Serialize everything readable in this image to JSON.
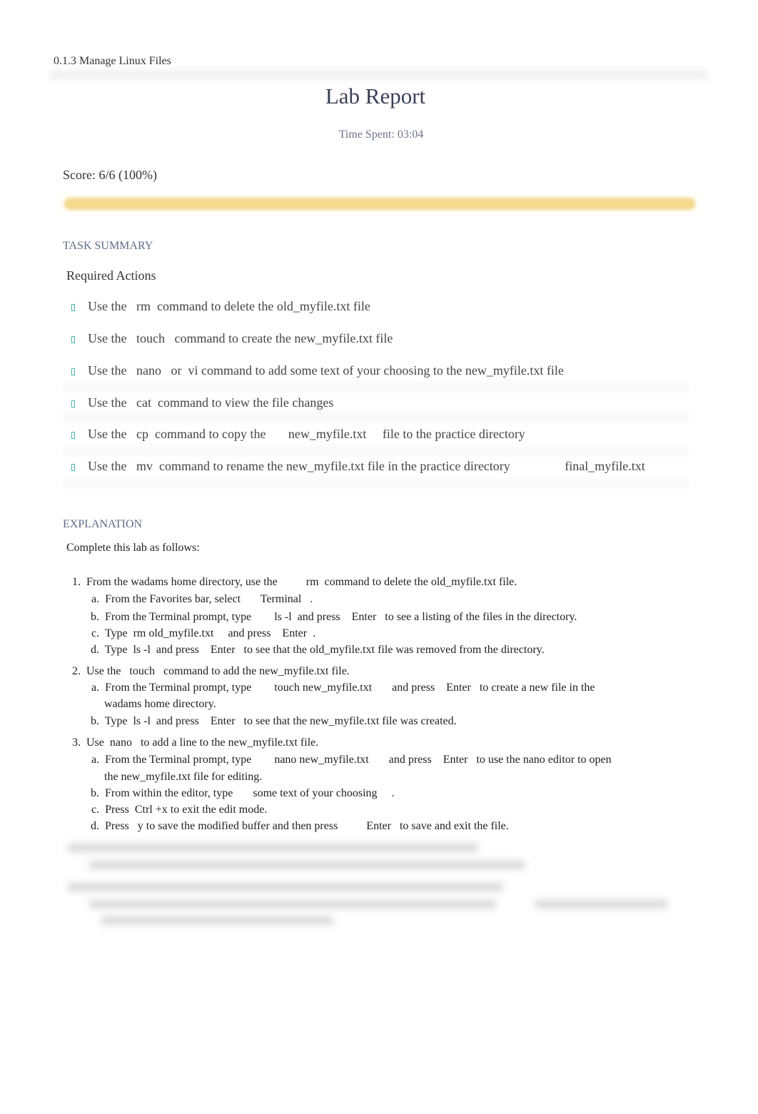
{
  "header": {
    "course": "0.1.3 Manage Linux Files"
  },
  "report": {
    "title": "Lab Report",
    "time_spent": "Time Spent: 03:04",
    "score": "Score: 6/6 (100%)",
    "score_percent": 100,
    "progress_color": "#f4d98f"
  },
  "task_summary": {
    "heading": "TASK SUMMARY",
    "subheading": "Required Actions",
    "icon": "check-icon",
    "items": [
      "Use the   rm  command to delete the old_myfile.txt file",
      "Use the   touch   command to create the new_myfile.txt file",
      "Use the   nano   or  vi command to add some text of your choosing to the new_myfile.txt file",
      "Use the   cat  command to view the file changes",
      "Use the   cp  command to copy the       new_myfile.txt     file to the practice directory",
      "Use the   mv  command to rename the new_myfile.txt file in the practice directory                 final_myfile.txt"
    ]
  },
  "explanation": {
    "heading": "EXPLANATION",
    "intro": "Complete this lab as follows:",
    "lines": [
      "1.  From the wadams home directory, use the          rm  command to delete the old_myfile.txt file.",
      "a.  From the Favorites bar, select       Terminal   .",
      "b.  From the Terminal prompt, type        ls -l  and press    Enter   to see a listing of the files in the directory.",
      "c.  Type  rm old_myfile.txt     and press    Enter  .",
      "d.  Type  ls -l  and press    Enter   to see that the old_myfile.txt file was removed from the directory.",
      "2.  Use the   touch   command to add the new_myfile.txt file.",
      "a.  From the Terminal prompt, type        touch new_myfile.txt       and press    Enter   to create a new file in the",
      "wadams home directory.",
      "b.  Type  ls -l  and press    Enter   to see that the new_myfile.txt file was created.",
      "3.  Use  nano   to add a line to the new_myfile.txt file.",
      "a.  From the Terminal prompt, type        nano new_myfile.txt       and press    Enter   to use the nano editor to open",
      "the new_myfile.txt file for editing.",
      "b.  From within the editor, type       some text of your choosing     .",
      "c.  Press  Ctrl +x to exit the edit mode.",
      "d.  Press   y to save the modified buffer and then press          Enter   to save and exit the file."
    ]
  }
}
